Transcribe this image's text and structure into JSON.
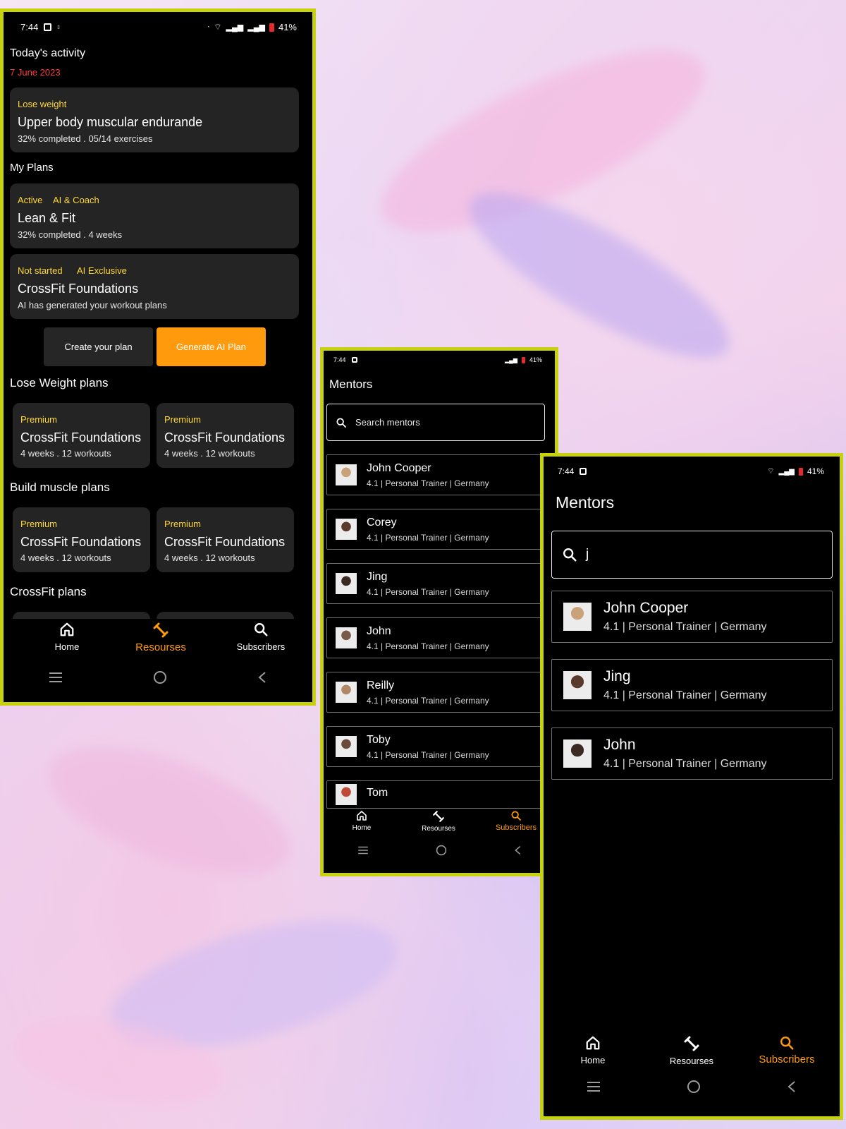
{
  "status": {
    "time": "7:44",
    "battery": "41%"
  },
  "phone1": {
    "today_title": "Today's activity",
    "today_date": "7 June 2023",
    "activity": {
      "tag": "Lose weight",
      "title": "Upper body muscular endurande",
      "sub": "32% completed . 05/14 exercises"
    },
    "my_plans_title": "My Plans",
    "plans": [
      {
        "tag1": "Active",
        "tag2": "AI & Coach",
        "title": "Lean & Fit",
        "sub": "32% completed . 4 weeks"
      },
      {
        "tag1": "Not started",
        "tag2": "AI Exclusive",
        "title": "CrossFit Foundations",
        "sub": "AI has generated your workout plans"
      }
    ],
    "create_btn": "Create your plan",
    "generate_btn": "Generate AI Plan",
    "sections": [
      {
        "title": "Lose Weight plans",
        "cards": [
          {
            "tag": "Premium",
            "title": "CrossFit Foundations",
            "sub": "4 weeks . 12 workouts"
          },
          {
            "tag": "Premium",
            "title": "CrossFit Foundations",
            "sub": "4 weeks . 12 workouts"
          }
        ]
      },
      {
        "title": "Build muscle plans",
        "cards": [
          {
            "tag": "Premium",
            "title": "CrossFit Foundations",
            "sub": "4 weeks . 12 workouts"
          },
          {
            "tag": "Premium",
            "title": "CrossFit Foundations",
            "sub": "4 weeks . 12 workouts"
          }
        ]
      },
      {
        "title": "CrossFit plans"
      }
    ]
  },
  "nav": {
    "home": "Home",
    "resources": "Resourses",
    "subscribers": "Subscribers"
  },
  "phone2": {
    "title": "Mentors",
    "search_placeholder": "Search mentors",
    "mentors": [
      {
        "name": "John Cooper",
        "meta": "4.1 | Personal Trainer | Germany"
      },
      {
        "name": "Corey",
        "meta": "4.1 | Personal Trainer | Germany"
      },
      {
        "name": "Jing",
        "meta": "4.1 | Personal Trainer | Germany"
      },
      {
        "name": "John",
        "meta": "4.1 | Personal Trainer | Germany"
      },
      {
        "name": "Reilly",
        "meta": "4.1 | Personal Trainer | Germany"
      },
      {
        "name": "Toby",
        "meta": "4.1 | Personal Trainer | Germany"
      },
      {
        "name": "Tom",
        "meta": ""
      }
    ]
  },
  "phone3": {
    "title": "Mentors",
    "search_value": "j",
    "mentors": [
      {
        "name": "John Cooper",
        "meta": "4.1 | Personal Trainer | Germany"
      },
      {
        "name": "Jing",
        "meta": "4.1 | Personal Trainer | Germany"
      },
      {
        "name": "John",
        "meta": "4.1 | Personal Trainer | Germany"
      }
    ]
  },
  "colors": {
    "accent": "#ff9a0c",
    "frame": "#c8d20c",
    "tag": "#ffd83a",
    "date": "#ff3b3b"
  }
}
